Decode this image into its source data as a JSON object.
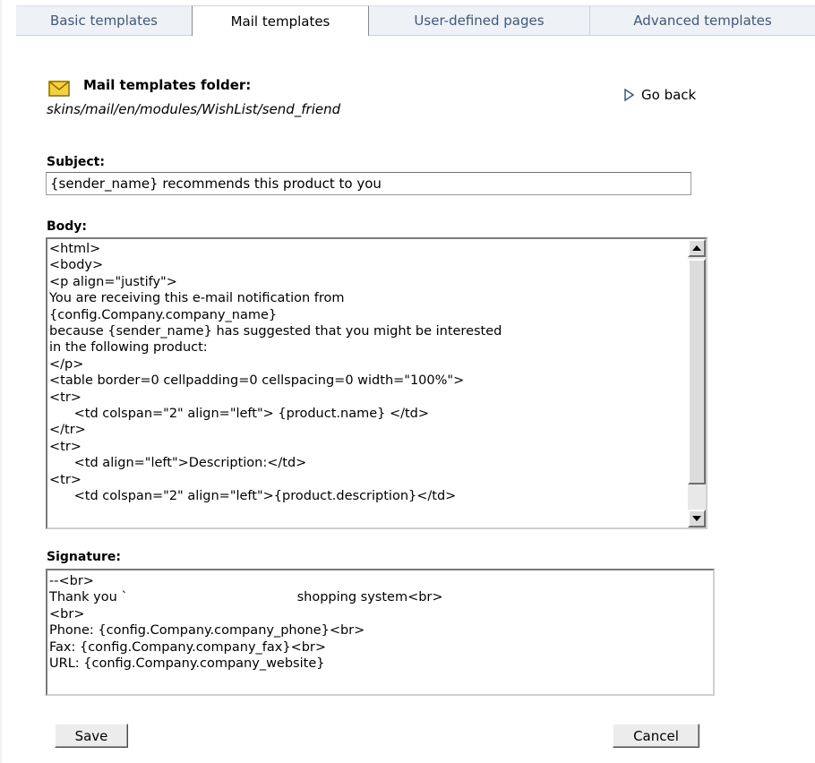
{
  "tabs": [
    {
      "label": "Basic templates",
      "active": false
    },
    {
      "label": "Mail templates",
      "active": true
    },
    {
      "label": "User-defined pages",
      "active": false
    },
    {
      "label": "Advanced templates",
      "active": false
    }
  ],
  "folder": {
    "icon": "envelope-icon",
    "label": "Mail templates folder:",
    "path": "skins/mail/en/modules/WishList/send_friend"
  },
  "go_back": {
    "icon": "arrow-right-icon",
    "label": "Go back"
  },
  "subject": {
    "label": "Subject:",
    "value": "{sender_name} recommends this product to you"
  },
  "body": {
    "label": "Body:",
    "value": "<html>\n<body>\n<p align=\"justify\">\nYou are receiving this e-mail notification from\n{config.Company.company_name}\nbecause {sender_name} has suggested that you might be interested\nin the following product:\n</p>\n<table border=0 cellpadding=0 cellspacing=0 width=\"100%\">\n<tr>\n      <td colspan=\"2\" align=\"left\"> {product.name} </td>\n</tr>\n<tr>\n      <td align=\"left\">Description:</td>\n<tr>\n      <td colspan=\"2\" align=\"left\">{product.description}</td>"
  },
  "signature": {
    "label": "Signature:",
    "value": "--<br>\nThank you `                                         shopping system<br>\n<br>\nPhone: {config.Company.company_phone}<br>\nFax: {config.Company.company_fax}<br>\nURL: {config.Company.company_website}"
  },
  "buttons": {
    "save": "Save",
    "cancel": "Cancel"
  },
  "colors": {
    "tab_text": "#3f5878",
    "tab_bg": "#eef1f6",
    "envelope": "#f4d23c"
  }
}
